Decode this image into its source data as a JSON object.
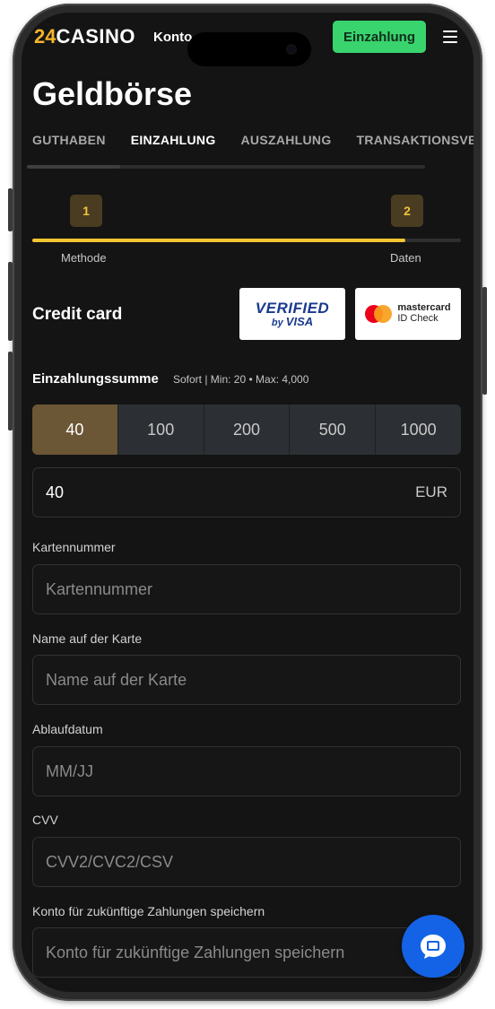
{
  "header": {
    "logo_number": "24",
    "logo_text": "CASINO",
    "nav_konto": "Konto",
    "deposit_button": "Einzahlung"
  },
  "page": {
    "title": "Geldbörse"
  },
  "tabs": [
    {
      "label": "GUTHABEN",
      "active": false
    },
    {
      "label": "EINZAHLUNG",
      "active": true
    },
    {
      "label": "AUSZAHLUNG",
      "active": false
    },
    {
      "label": "TRANSAKTIONSVE",
      "active": false
    }
  ],
  "stepper": {
    "steps": [
      {
        "number": "1",
        "label": "Methode"
      },
      {
        "number": "2",
        "label": "Daten"
      }
    ],
    "progress_fraction": 0.87
  },
  "payment": {
    "method_title": "Credit card",
    "visa_badge": {
      "line1": "VERIFIED",
      "line2_prefix": "by",
      "line2_brand": "VISA"
    },
    "mastercard_badge": {
      "line1": "mastercard",
      "line2": "ID Check"
    }
  },
  "amount": {
    "label": "Einzahlungssumme",
    "hint": "Sofort | Min: 20 • Max: 4,000",
    "options": [
      "40",
      "100",
      "200",
      "500",
      "1000"
    ],
    "selected": "40",
    "value": "40",
    "currency": "EUR"
  },
  "fields": [
    {
      "label": "Kartennummer",
      "placeholder": "Kartennummer"
    },
    {
      "label": "Name auf der Karte",
      "placeholder": "Name auf der Karte"
    },
    {
      "label": "Ablaufdatum",
      "placeholder": "MM/JJ"
    },
    {
      "label": "CVV",
      "placeholder": "CVV2/CVC2/CSV"
    },
    {
      "label": "Konto für zukünftige Zahlungen speichern",
      "placeholder": "Konto für zukünftige Zahlungen speichern"
    }
  ],
  "colors": {
    "accent_green": "#39d46e",
    "accent_gold": "#f2c430",
    "selected_amount": "#6b5636",
    "chat_blue": "#1463e6"
  },
  "icons": [
    "menu-icon",
    "chat-icon",
    "camera-icon"
  ]
}
